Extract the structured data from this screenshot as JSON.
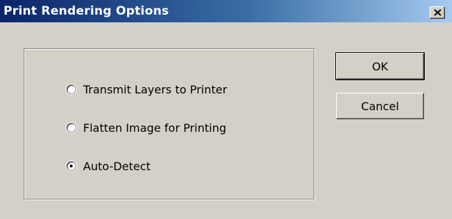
{
  "window": {
    "title": "Print Rendering Options",
    "close_icon": "close-icon"
  },
  "options": [
    {
      "label": "Transmit Layers to Printer",
      "checked": false
    },
    {
      "label": "Flatten Image for Printing",
      "checked": false
    },
    {
      "label": "Auto-Detect",
      "checked": true
    }
  ],
  "buttons": {
    "ok_label": "OK",
    "cancel_label": "Cancel"
  },
  "colors": {
    "title_bar_start": "#0a246a",
    "title_bar_end": "#a6caf0",
    "dialog_bg": "#d4d0c8"
  }
}
